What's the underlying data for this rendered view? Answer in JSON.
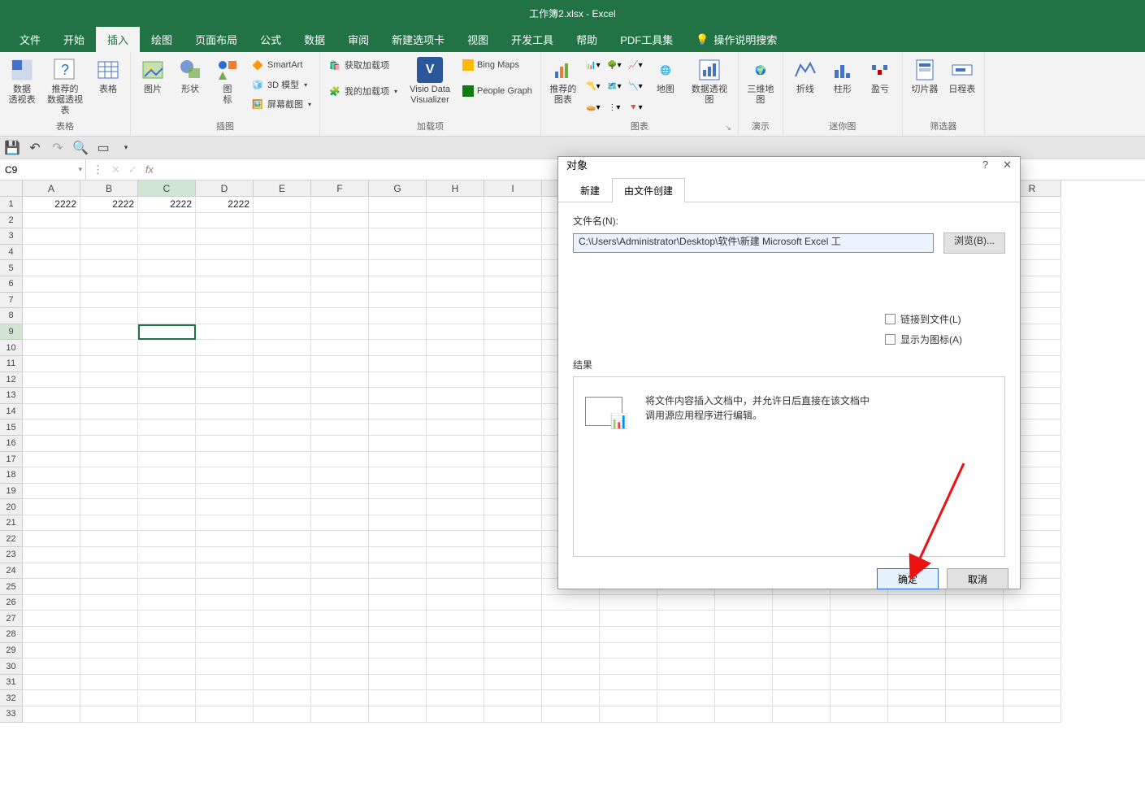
{
  "title": "工作簿2.xlsx  -  Excel",
  "tabs": [
    "文件",
    "开始",
    "插入",
    "绘图",
    "页面布局",
    "公式",
    "数据",
    "审阅",
    "新建选项卡",
    "视图",
    "开发工具",
    "帮助",
    "PDF工具集"
  ],
  "tell_me": "操作说明搜索",
  "active_tab": "插入",
  "ribbon": {
    "tables": {
      "pivot": "数据\n透视表",
      "rec_pivot": "推荐的\n数据透视表",
      "table": "表格",
      "group": "表格"
    },
    "illustrations": {
      "pic": "图片",
      "shapes": "形状",
      "icons": "图\n标",
      "smartart": "SmartArt",
      "model3d": "3D 模型",
      "screenshot": "屏幕截图",
      "group": "插图"
    },
    "addins": {
      "get": "获取加载项",
      "my": "我的加载项",
      "visio": "Visio Data\nVisualizer",
      "bing": "Bing Maps",
      "people": "People Graph",
      "group": "加载项"
    },
    "charts": {
      "recommended": "推荐的\n图表",
      "map": "地图",
      "pivotchart": "数据透视图",
      "group": "图表"
    },
    "tours": {
      "map3d": "三维地\n图",
      "group": "演示"
    },
    "sparklines": {
      "line": "折线",
      "column": "柱形",
      "winloss": "盈亏",
      "group": "迷你图"
    },
    "filters": {
      "slicer": "切片器",
      "timeline": "日程表",
      "group": "筛选器"
    }
  },
  "name_box": "C9",
  "columns": [
    "A",
    "B",
    "C",
    "D",
    "E",
    "F",
    "G",
    "H",
    "I",
    "R"
  ],
  "row_count": 33,
  "data_row1": [
    "2222",
    "2222",
    "2222",
    "2222"
  ],
  "selected_cell": {
    "row": 9,
    "col": 3
  },
  "dialog": {
    "title": "对象",
    "tab_new": "新建",
    "tab_fromfile": "由文件创建",
    "filename_label": "文件名(N):",
    "filename_value": "C:\\Users\\Administrator\\Desktop\\软件\\新建 Microsoft Excel 工",
    "browse": "浏览(B)...",
    "link": "链接到文件(L)",
    "asicon": "显示为图标(A)",
    "result_label": "结果",
    "result_desc": "将文件内容插入文档中，并允许日后直接在该文档中调用源应用程序进行编辑。",
    "ok": "确定",
    "cancel": "取消"
  }
}
